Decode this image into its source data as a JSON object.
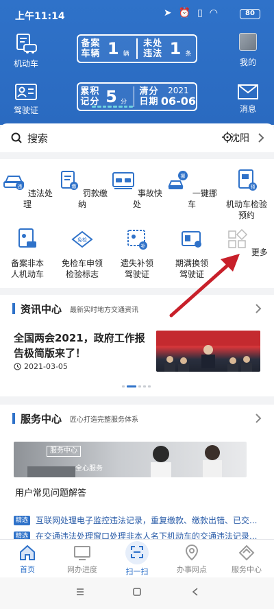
{
  "status": {
    "time": "上午11:14",
    "battery": "80"
  },
  "header": {
    "left_top_label": "机动车",
    "left_bottom_label": "驾驶证",
    "right_top_label": "我的",
    "right_bottom_label": "消息",
    "card1": {
      "label1": "备案\n车辆",
      "value1": "1",
      "unit1": "辆",
      "label2": "未处\n违法",
      "value2": "1",
      "unit2": "条"
    },
    "card2": {
      "label1": "累积\n记分",
      "value1": "5",
      "unit1": "分",
      "label2": "清分\n日期",
      "year": "2021",
      "date": "06-06"
    }
  },
  "search": {
    "placeholder": "搜索",
    "city": "沈阳"
  },
  "grid": {
    "items": [
      {
        "label": "违法处理",
        "icon": "car-violation-icon"
      },
      {
        "label": "罚款缴纳",
        "icon": "fine-payment-icon"
      },
      {
        "label": "事故快处",
        "icon": "accident-icon"
      },
      {
        "label": "一键挪车",
        "icon": "move-car-icon"
      },
      {
        "label": "机动车检验预约",
        "icon": "inspection-booking-icon"
      },
      {
        "label": "备案非本人机动车",
        "icon": "register-vehicle-icon"
      },
      {
        "label": "免检车申领检验标志",
        "icon": "exempt-inspection-icon"
      },
      {
        "label": "遗失补领驾驶证",
        "icon": "replace-license-icon"
      },
      {
        "label": "期满换领驾驶证",
        "icon": "renew-license-icon"
      },
      {
        "label": "更多",
        "icon": "more-icon"
      }
    ]
  },
  "news": {
    "title": "资讯中心",
    "subtitle": "最新实时地方交通资讯",
    "headline": "全国两会2021，政府工作报告极简版来了！",
    "date": "2021-03-05"
  },
  "service": {
    "title": "服务中心",
    "subtitle": "匠心打造完整服务体系",
    "banner_tag": "服务中心",
    "banner_text": "全心服务",
    "faq_title": "用户常见问题解答",
    "faq_tag": "精选",
    "faqs": [
      "互联网处理电子监控违法记录，重复缴款、缴款出错、已交...",
      "在交通违法处理窗口处理非本人名下机动车的交通违法记录..."
    ]
  },
  "bottom_nav": {
    "items": [
      "首页",
      "网办进度",
      "扫一扫",
      "办事网点",
      "服务中心"
    ]
  },
  "colors": {
    "primary": "#2f72c9",
    "arrow": "#c8202a"
  }
}
